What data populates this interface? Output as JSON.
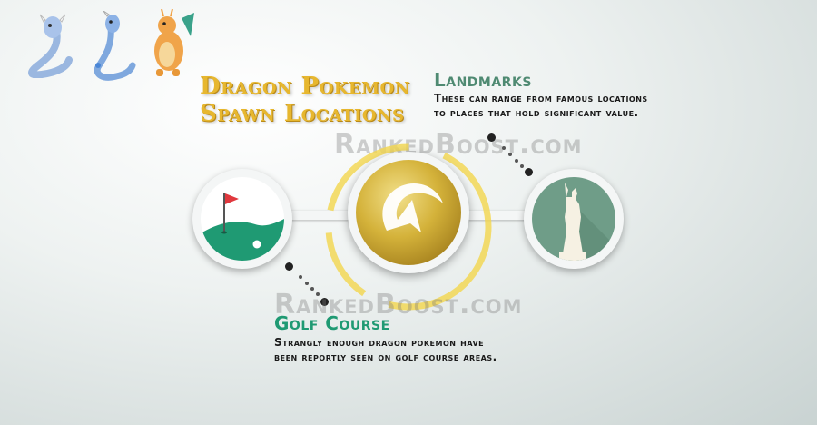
{
  "title": {
    "line1": "Dragon Pokemon",
    "line2": "Spawn Locations"
  },
  "landmarks": {
    "heading": "Landmarks",
    "line1": "These can range from famous locations",
    "line2": "to places that hold significant value."
  },
  "golf": {
    "heading": "Golf Course",
    "line1": "Strangly enough dragon pokemon have",
    "line2": "been reportly seen on golf course areas."
  },
  "watermark": "RankedBoost.com",
  "icons": [
    "dratini-icon",
    "dragonair-icon",
    "dragonite-icon",
    "golf-course-icon",
    "pokemon-go-gym-icon",
    "statue-of-liberty-icon"
  ],
  "colors": {
    "title_gold": "#e7b72f",
    "golf_green": "#1f9a73",
    "landmark_green": "#4f8a72",
    "statue_circle": "#6f9d88"
  }
}
